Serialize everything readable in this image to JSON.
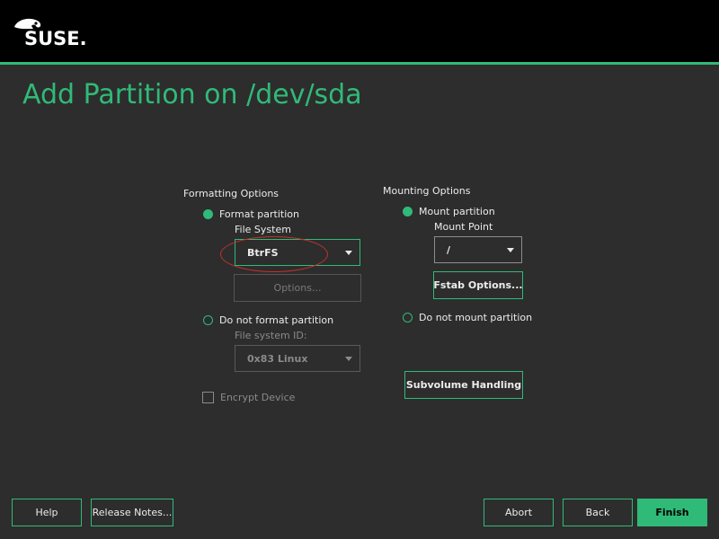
{
  "brand": {
    "logo_text": "SUSE.",
    "accent": "#30ba78",
    "header_bg": "#000000",
    "bg": "#2d2d2d"
  },
  "page": {
    "title": "Add Partition on /dev/sda"
  },
  "formatting": {
    "group_label": "Formatting Options",
    "format_radio_label": "Format partition",
    "format_selected": true,
    "file_system_label": "File System",
    "file_system_value": "BtrFS",
    "options_button": "Options...",
    "no_format_radio_label": "Do not format partition",
    "file_system_id_label": "File system ID:",
    "file_system_id_value": "0x83 Linux",
    "encrypt_label": "Encrypt Device",
    "encrypt_checked": false
  },
  "mounting": {
    "group_label": "Mounting Options",
    "mount_radio_label": "Mount partition",
    "mount_selected": true,
    "mount_point_label": "Mount Point",
    "mount_point_value": "/",
    "fstab_button": "Fstab Options...",
    "no_mount_radio_label": "Do not mount partition",
    "subvolume_button": "Subvolume Handling"
  },
  "footer": {
    "help": "Help",
    "release_notes": "Release Notes...",
    "abort": "Abort",
    "back": "Back",
    "finish": "Finish"
  },
  "annotation": {
    "color": "#c8312b"
  }
}
